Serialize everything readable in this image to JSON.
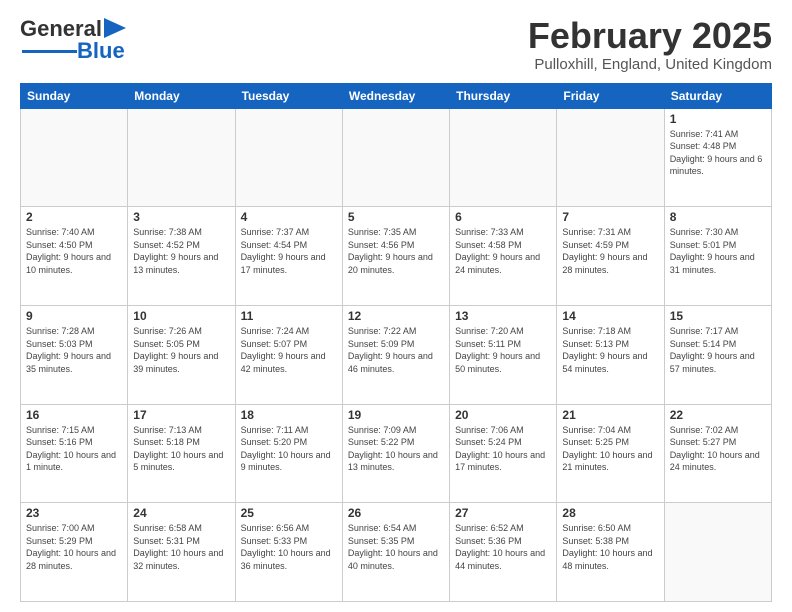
{
  "header": {
    "logo_general": "General",
    "logo_blue": "Blue",
    "month_title": "February 2025",
    "location": "Pulloxhill, England, United Kingdom"
  },
  "days_of_week": [
    "Sunday",
    "Monday",
    "Tuesday",
    "Wednesday",
    "Thursday",
    "Friday",
    "Saturday"
  ],
  "weeks": [
    [
      {
        "day": "",
        "info": ""
      },
      {
        "day": "",
        "info": ""
      },
      {
        "day": "",
        "info": ""
      },
      {
        "day": "",
        "info": ""
      },
      {
        "day": "",
        "info": ""
      },
      {
        "day": "",
        "info": ""
      },
      {
        "day": "1",
        "info": "Sunrise: 7:41 AM\nSunset: 4:48 PM\nDaylight: 9 hours and 6 minutes."
      }
    ],
    [
      {
        "day": "2",
        "info": "Sunrise: 7:40 AM\nSunset: 4:50 PM\nDaylight: 9 hours and 10 minutes."
      },
      {
        "day": "3",
        "info": "Sunrise: 7:38 AM\nSunset: 4:52 PM\nDaylight: 9 hours and 13 minutes."
      },
      {
        "day": "4",
        "info": "Sunrise: 7:37 AM\nSunset: 4:54 PM\nDaylight: 9 hours and 17 minutes."
      },
      {
        "day": "5",
        "info": "Sunrise: 7:35 AM\nSunset: 4:56 PM\nDaylight: 9 hours and 20 minutes."
      },
      {
        "day": "6",
        "info": "Sunrise: 7:33 AM\nSunset: 4:58 PM\nDaylight: 9 hours and 24 minutes."
      },
      {
        "day": "7",
        "info": "Sunrise: 7:31 AM\nSunset: 4:59 PM\nDaylight: 9 hours and 28 minutes."
      },
      {
        "day": "8",
        "info": "Sunrise: 7:30 AM\nSunset: 5:01 PM\nDaylight: 9 hours and 31 minutes."
      }
    ],
    [
      {
        "day": "9",
        "info": "Sunrise: 7:28 AM\nSunset: 5:03 PM\nDaylight: 9 hours and 35 minutes."
      },
      {
        "day": "10",
        "info": "Sunrise: 7:26 AM\nSunset: 5:05 PM\nDaylight: 9 hours and 39 minutes."
      },
      {
        "day": "11",
        "info": "Sunrise: 7:24 AM\nSunset: 5:07 PM\nDaylight: 9 hours and 42 minutes."
      },
      {
        "day": "12",
        "info": "Sunrise: 7:22 AM\nSunset: 5:09 PM\nDaylight: 9 hours and 46 minutes."
      },
      {
        "day": "13",
        "info": "Sunrise: 7:20 AM\nSunset: 5:11 PM\nDaylight: 9 hours and 50 minutes."
      },
      {
        "day": "14",
        "info": "Sunrise: 7:18 AM\nSunset: 5:13 PM\nDaylight: 9 hours and 54 minutes."
      },
      {
        "day": "15",
        "info": "Sunrise: 7:17 AM\nSunset: 5:14 PM\nDaylight: 9 hours and 57 minutes."
      }
    ],
    [
      {
        "day": "16",
        "info": "Sunrise: 7:15 AM\nSunset: 5:16 PM\nDaylight: 10 hours and 1 minute."
      },
      {
        "day": "17",
        "info": "Sunrise: 7:13 AM\nSunset: 5:18 PM\nDaylight: 10 hours and 5 minutes."
      },
      {
        "day": "18",
        "info": "Sunrise: 7:11 AM\nSunset: 5:20 PM\nDaylight: 10 hours and 9 minutes."
      },
      {
        "day": "19",
        "info": "Sunrise: 7:09 AM\nSunset: 5:22 PM\nDaylight: 10 hours and 13 minutes."
      },
      {
        "day": "20",
        "info": "Sunrise: 7:06 AM\nSunset: 5:24 PM\nDaylight: 10 hours and 17 minutes."
      },
      {
        "day": "21",
        "info": "Sunrise: 7:04 AM\nSunset: 5:25 PM\nDaylight: 10 hours and 21 minutes."
      },
      {
        "day": "22",
        "info": "Sunrise: 7:02 AM\nSunset: 5:27 PM\nDaylight: 10 hours and 24 minutes."
      }
    ],
    [
      {
        "day": "23",
        "info": "Sunrise: 7:00 AM\nSunset: 5:29 PM\nDaylight: 10 hours and 28 minutes."
      },
      {
        "day": "24",
        "info": "Sunrise: 6:58 AM\nSunset: 5:31 PM\nDaylight: 10 hours and 32 minutes."
      },
      {
        "day": "25",
        "info": "Sunrise: 6:56 AM\nSunset: 5:33 PM\nDaylight: 10 hours and 36 minutes."
      },
      {
        "day": "26",
        "info": "Sunrise: 6:54 AM\nSunset: 5:35 PM\nDaylight: 10 hours and 40 minutes."
      },
      {
        "day": "27",
        "info": "Sunrise: 6:52 AM\nSunset: 5:36 PM\nDaylight: 10 hours and 44 minutes."
      },
      {
        "day": "28",
        "info": "Sunrise: 6:50 AM\nSunset: 5:38 PM\nDaylight: 10 hours and 48 minutes."
      },
      {
        "day": "",
        "info": ""
      }
    ]
  ]
}
